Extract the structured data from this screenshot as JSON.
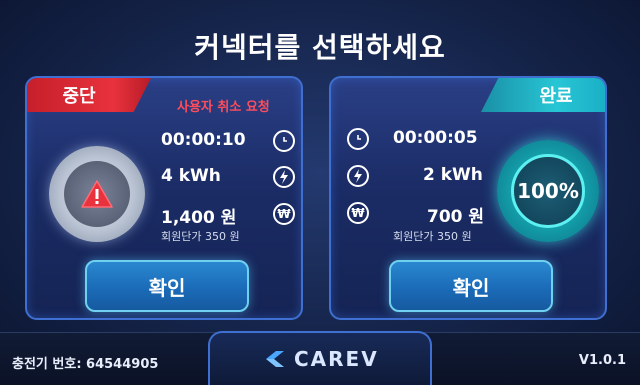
{
  "header": {
    "title": "커넥터를 선택하세요"
  },
  "left_panel": {
    "status_label": "중단",
    "request_text": "사용자 취소 요청",
    "time": "00:00:10",
    "energy": "4 kWh",
    "amount": "1,400 원",
    "unit_price_label": "회원단가  350 원",
    "confirm_label": "확인"
  },
  "right_panel": {
    "status_label": "완료",
    "time": "00:00:05",
    "energy": "2 kWh",
    "amount": "700 원",
    "unit_price_label": "회원단가  350 원",
    "progress_label": "100%",
    "progress_fraction": 1.0,
    "confirm_label": "확인"
  },
  "icons": {
    "time": "clock-icon",
    "energy": "lightning-icon",
    "amount": "won-icon",
    "warning": "warning-icon"
  },
  "footer": {
    "charger_label": "충전기 번호: 64544905",
    "brand": "CAREV",
    "version": "V1.0.1"
  },
  "colors": {
    "stop": "#e8323d",
    "done": "#27c6d5",
    "confirm": "#1b6bb8"
  }
}
